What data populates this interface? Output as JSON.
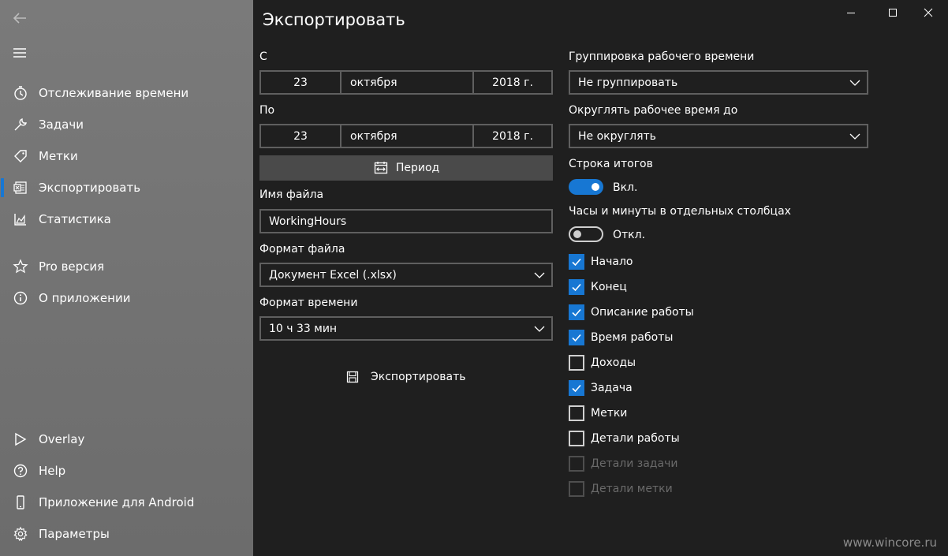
{
  "window": {
    "title": "Экспортировать"
  },
  "sidebar": {
    "items": [
      {
        "label": "Отслеживание времени",
        "icon": "stopwatch-icon"
      },
      {
        "label": "Задачи",
        "icon": "wrench-icon"
      },
      {
        "label": "Метки",
        "icon": "tag-icon"
      },
      {
        "label": "Экспортировать",
        "icon": "excel-icon",
        "selected": true
      },
      {
        "label": "Статистика",
        "icon": "area-chart-icon"
      },
      {
        "label": "Pro версия",
        "icon": "star-icon"
      },
      {
        "label": "О приложении",
        "icon": "info-icon"
      }
    ],
    "bottom_items": [
      {
        "label": "Overlay",
        "icon": "overlay-icon"
      },
      {
        "label": "Help",
        "icon": "help-icon"
      },
      {
        "label": "Приложение для Android",
        "icon": "phone-icon"
      },
      {
        "label": "Параметры",
        "icon": "gear-icon"
      }
    ]
  },
  "left": {
    "from_label": "С",
    "from": {
      "day": "23",
      "month": "октября",
      "year": "2018 г."
    },
    "to_label": "По",
    "to": {
      "day": "23",
      "month": "октября",
      "year": "2018 г."
    },
    "period_label": "Период",
    "filename_label": "Имя файла",
    "filename_value": "WorkingHours",
    "file_format_label": "Формат файла",
    "file_format_value": "Документ Excel (.xlsx)",
    "time_format_label": "Формат времени",
    "time_format_value": "10 ч 33 мин",
    "export_label": "Экспортировать"
  },
  "right": {
    "grouping_label": "Группировка рабочего времени",
    "grouping_value": "Не группировать",
    "rounding_label": "Округлять рабочее время до",
    "rounding_value": "Не округлять",
    "totals_label": "Строка итогов",
    "totals_state": "Вкл.",
    "columns_label": "Часы и минуты в отдельных столбцах",
    "columns_state": "Откл.",
    "checkboxes": [
      {
        "label": "Начало",
        "checked": true,
        "enabled": true
      },
      {
        "label": "Конец",
        "checked": true,
        "enabled": true
      },
      {
        "label": "Описание работы",
        "checked": true,
        "enabled": true
      },
      {
        "label": "Время работы",
        "checked": true,
        "enabled": true
      },
      {
        "label": "Доходы",
        "checked": false,
        "enabled": true
      },
      {
        "label": "Задача",
        "checked": true,
        "enabled": true
      },
      {
        "label": "Метки",
        "checked": false,
        "enabled": true
      },
      {
        "label": "Детали работы",
        "checked": false,
        "enabled": true
      },
      {
        "label": "Детали задачи",
        "checked": false,
        "enabled": false
      },
      {
        "label": "Детали метки",
        "checked": false,
        "enabled": false
      }
    ]
  },
  "colors": {
    "accent": "#1777d3",
    "sidebar": "#727272",
    "background": "#1f1f1f"
  },
  "watermark": "www.wincore.ru"
}
